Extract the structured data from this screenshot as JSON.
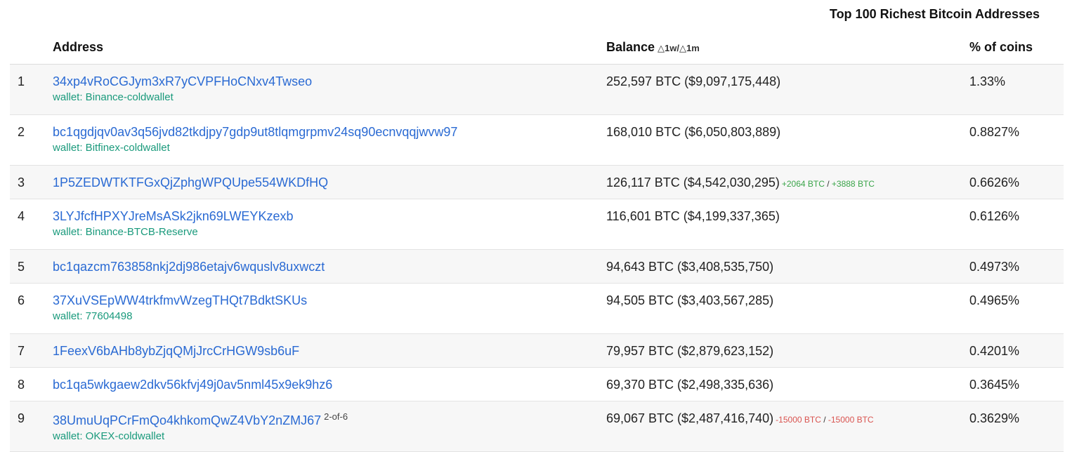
{
  "page": {
    "title": "Top 100 Richest Bitcoin Addresses"
  },
  "table": {
    "headers": {
      "rank": "",
      "address": "Address",
      "balance": "Balance",
      "balance_delta": "△1w/△1m",
      "percent": "% of coins"
    },
    "rows": [
      {
        "rank": "1",
        "address": "34xp4vRoCGJym3xR7yCVPFHoCNxv4Twseo",
        "multisig": "",
        "wallet": "wallet: Binance-coldwallet",
        "balance": "252,597 BTC ($9,097,175,448)",
        "change_week": "",
        "change_sep": "",
        "change_month": "",
        "change_sign": "",
        "percent": "1.33%"
      },
      {
        "rank": "2",
        "address": "bc1qgdjqv0av3q56jvd82tkdjpy7gdp9ut8tlqmgrpmv24sq90ecnvqqjwvw97",
        "multisig": "",
        "wallet": "wallet: Bitfinex-coldwallet",
        "balance": "168,010 BTC ($6,050,803,889)",
        "change_week": "",
        "change_sep": "",
        "change_month": "",
        "change_sign": "",
        "percent": "0.8827%"
      },
      {
        "rank": "3",
        "address": "1P5ZEDWTKTFGxQjZphgWPQUpe554WKDfHQ",
        "multisig": "",
        "wallet": "",
        "balance": "126,117 BTC ($4,542,030,295)",
        "change_week": "+2064 BTC",
        "change_sep": " / ",
        "change_month": "+3888 BTC",
        "change_sign": "pos",
        "percent": "0.6626%"
      },
      {
        "rank": "4",
        "address": "3LYJfcfHPXYJreMsASk2jkn69LWEYKzexb",
        "multisig": "",
        "wallet": "wallet: Binance-BTCB-Reserve",
        "balance": "116,601 BTC ($4,199,337,365)",
        "change_week": "",
        "change_sep": "",
        "change_month": "",
        "change_sign": "",
        "percent": "0.6126%"
      },
      {
        "rank": "5",
        "address": "bc1qazcm763858nkj2dj986etajv6wquslv8uxwczt",
        "multisig": "",
        "wallet": "",
        "balance": "94,643 BTC ($3,408,535,750)",
        "change_week": "",
        "change_sep": "",
        "change_month": "",
        "change_sign": "",
        "percent": "0.4973%"
      },
      {
        "rank": "6",
        "address": "37XuVSEpWW4trkfmvWzegTHQt7BdktSKUs",
        "multisig": "",
        "wallet": "wallet: 77604498",
        "balance": "94,505 BTC ($3,403,567,285)",
        "change_week": "",
        "change_sep": "",
        "change_month": "",
        "change_sign": "",
        "percent": "0.4965%"
      },
      {
        "rank": "7",
        "address": "1FeexV6bAHb8ybZjqQMjJrcCrHGW9sb6uF",
        "multisig": "",
        "wallet": "",
        "balance": "79,957 BTC ($2,879,623,152)",
        "change_week": "",
        "change_sep": "",
        "change_month": "",
        "change_sign": "",
        "percent": "0.4201%"
      },
      {
        "rank": "8",
        "address": "bc1qa5wkgaew2dkv56kfvj49j0av5nml45x9ek9hz6",
        "multisig": "",
        "wallet": "",
        "balance": "69,370 BTC ($2,498,335,636)",
        "change_week": "",
        "change_sep": "",
        "change_month": "",
        "change_sign": "",
        "percent": "0.3645%"
      },
      {
        "rank": "9",
        "address": "38UmuUqPCrFmQo4khkomQwZ4VbY2nZMJ67",
        "multisig": "2-of-6",
        "wallet": "wallet: OKEX-coldwallet",
        "balance": "69,067 BTC ($2,487,416,740)",
        "change_week": "-15000 BTC",
        "change_sep": " / ",
        "change_month": "-15000 BTC",
        "change_sign": "neg",
        "percent": "0.3629%"
      }
    ]
  },
  "colors": {
    "link": "#2a6ad3",
    "wallet": "#1a9a7c",
    "positive_change": "#3ba54a",
    "negative_change": "#d9534f",
    "stripe": "#f7f7f7"
  }
}
